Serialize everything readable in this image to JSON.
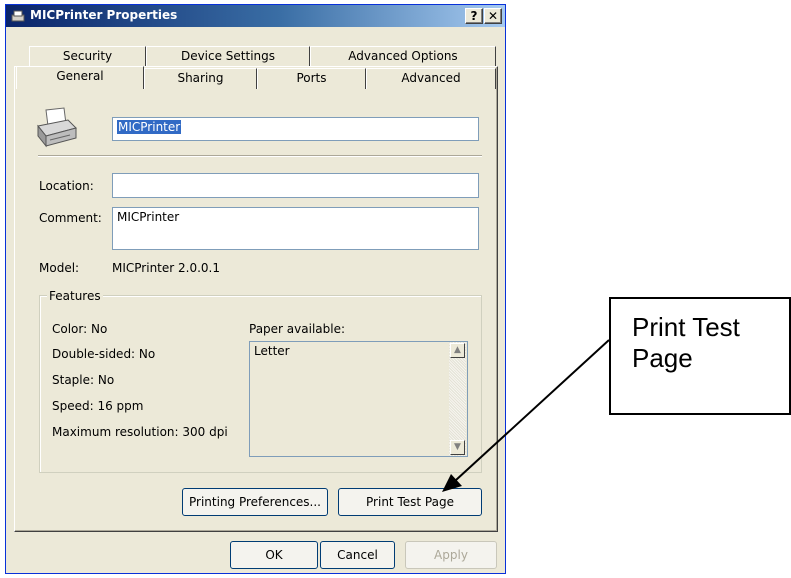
{
  "window": {
    "title": "MICPrinter Properties",
    "help_label": "?",
    "close_label": "✕"
  },
  "tabs_row1": [
    "Security",
    "Device Settings",
    "Advanced Options"
  ],
  "tabs_row2": [
    "General",
    "Sharing",
    "Ports",
    "Advanced"
  ],
  "active_tab": "General",
  "general": {
    "printer_name": "MICPrinter",
    "location_label": "Location:",
    "location_value": "",
    "comment_label": "Comment:",
    "comment_value": "MICPrinter",
    "model_label": "Model:",
    "model_value": "MICPrinter 2.0.0.1",
    "features_title": "Features",
    "color": "Color: No",
    "double_sided": "Double-sided: No",
    "staple": "Staple: No",
    "speed": "Speed: 16 ppm",
    "max_resolution": "Maximum resolution: 300 dpi",
    "paper_label": "Paper available:",
    "paper_items": [
      "Letter"
    ],
    "printing_prefs_label": "Printing Preferences...",
    "print_test_label": "Print Test Page"
  },
  "footer": {
    "ok_label": "OK",
    "cancel_label": "Cancel",
    "apply_label": "Apply"
  },
  "callout": {
    "line1": "Print Test",
    "line2": "Page"
  },
  "icons": [
    "printer-icon",
    "app-icon",
    "scroll-up-icon",
    "scroll-down-icon",
    "arrow-icon"
  ]
}
